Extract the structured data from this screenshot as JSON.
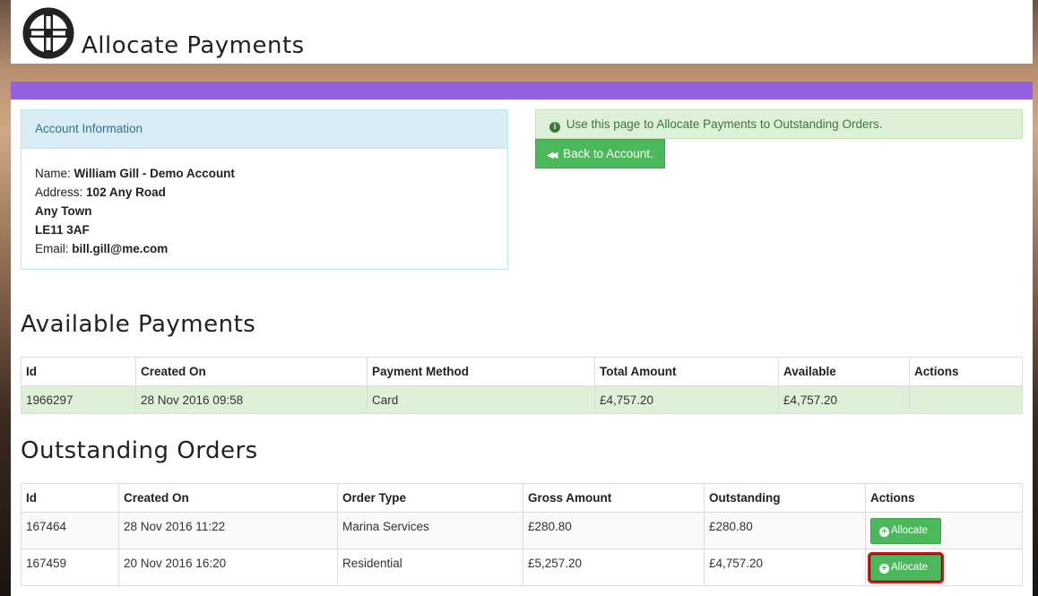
{
  "header": {
    "title": "Allocate Payments",
    "logo_icon": "crosshair-circle-icon"
  },
  "account": {
    "panel_title": "Account Information",
    "name_label": "Name:",
    "name": "William Gill - Demo Account",
    "address_label": "Address:",
    "address_line1": "102 Any Road",
    "address_line2": "Any Town",
    "postcode": "LE11 3AF",
    "email_label": "Email:",
    "email": "bill.gill@me.com"
  },
  "info": {
    "icon": "info-circle-icon",
    "message": "Use this page to Allocate Payments to Outstanding Orders."
  },
  "back_button": {
    "icon": "backward-icon",
    "label": "Back to Account."
  },
  "payments": {
    "heading": "Available Payments",
    "columns": [
      "Id",
      "Created On",
      "Payment Method",
      "Total Amount",
      "Available",
      "Actions"
    ],
    "rows": [
      {
        "id": "1966297",
        "created": "28 Nov 2016 09:58",
        "method": "Card",
        "total": "£4,757.20",
        "available": "£4,757.20"
      }
    ]
  },
  "orders": {
    "heading": "Outstanding Orders",
    "columns": [
      "Id",
      "Created On",
      "Order Type",
      "Gross Amount",
      "Outstanding",
      "Actions"
    ],
    "allocate_label": "Allocate",
    "allocate_icon": "plus-circle-icon",
    "rows": [
      {
        "id": "167464",
        "created": "28 Nov 2016 11:22",
        "type": "Marina Services",
        "gross": "£280.80",
        "outstanding": "£280.80"
      },
      {
        "id": "167459",
        "created": "20 Nov 2016 16:20",
        "type": "Residential",
        "gross": "£5,257.20",
        "outstanding": "£4,757.20"
      }
    ]
  },
  "colors": {
    "accent_bar": "#9462e0",
    "success": "#4cb85c",
    "highlight": "#d0201a"
  }
}
